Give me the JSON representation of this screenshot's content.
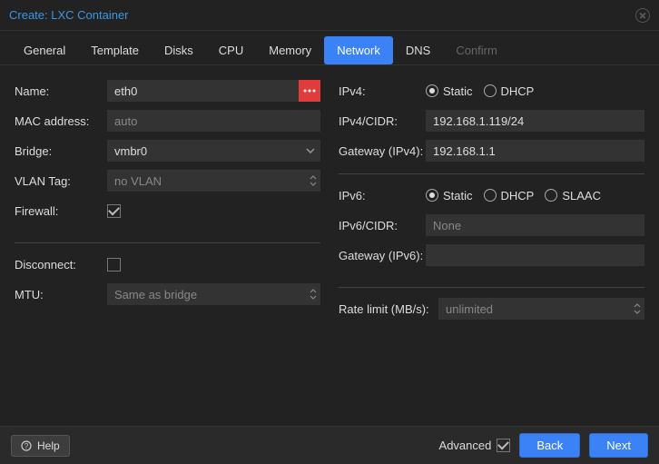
{
  "title": "Create: LXC Container",
  "tabs": {
    "general": "General",
    "template": "Template",
    "disks": "Disks",
    "cpu": "CPU",
    "memory": "Memory",
    "network": "Network",
    "dns": "DNS",
    "confirm": "Confirm"
  },
  "left": {
    "name_label": "Name:",
    "name_value": "eth0",
    "mac_label": "MAC address:",
    "mac_placeholder": "auto",
    "bridge_label": "Bridge:",
    "bridge_value": "vmbr0",
    "vlan_label": "VLAN Tag:",
    "vlan_placeholder": "no VLAN",
    "firewall_label": "Firewall:",
    "disconnect_label": "Disconnect:",
    "mtu_label": "MTU:",
    "mtu_placeholder": "Same as bridge"
  },
  "right": {
    "ipv4_label": "IPv4:",
    "ipv4_static": "Static",
    "ipv4_dhcp": "DHCP",
    "ipv4cidr_label": "IPv4/CIDR:",
    "ipv4cidr_value": "192.168.1.119/24",
    "gw4_label": "Gateway (IPv4):",
    "gw4_value": "192.168.1.1",
    "ipv6_label": "IPv6:",
    "ipv6_static": "Static",
    "ipv6_dhcp": "DHCP",
    "ipv6_slaac": "SLAAC",
    "ipv6cidr_label": "IPv6/CIDR:",
    "ipv6cidr_placeholder": "None",
    "gw6_label": "Gateway (IPv6):",
    "rate_label": "Rate limit (MB/s):",
    "rate_placeholder": "unlimited"
  },
  "footer": {
    "help": "Help",
    "advanced": "Advanced",
    "back": "Back",
    "next": "Next"
  }
}
